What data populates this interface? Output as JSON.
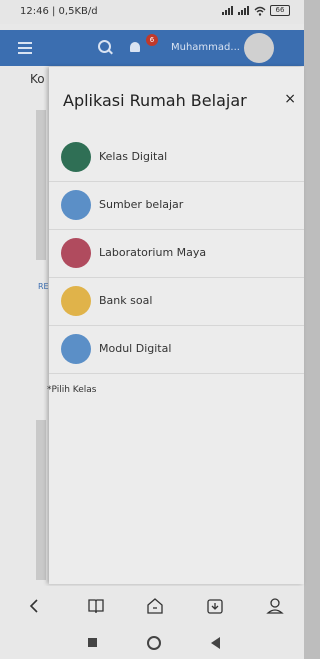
{
  "status_bar": {
    "time": "12:46 | 0,5KB/d",
    "battery": "66"
  },
  "app_bar": {
    "notification_count": "6",
    "user_name": "Muhammad..."
  },
  "background": {
    "partial_heading": "Ko",
    "partial_label": "RE"
  },
  "drawer": {
    "title": "Aplikasi Rumah Belajar",
    "close": "×",
    "items": [
      {
        "label": "Kelas Digital",
        "icon": "kelas-digital-icon",
        "color": "#2f6f55"
      },
      {
        "label": "Sumber belajar",
        "icon": "sumber-belajar-icon",
        "color": "#5b8fc7"
      },
      {
        "label": "Laboratorium Maya",
        "icon": "laboratorium-maya-icon",
        "color": "#b04b5e"
      },
      {
        "label": "Bank soal",
        "icon": "bank-soal-icon",
        "color": "#e0b34a"
      },
      {
        "label": "Modul Digital",
        "icon": "modul-digital-icon",
        "color": "#5b8fc7"
      }
    ],
    "footer_label": "Pilih Kelas",
    "footer_prefix": "*"
  },
  "bottom_nav": [
    "back-icon",
    "book-icon",
    "home-icon",
    "download-folder-icon",
    "profile-icon"
  ],
  "system_nav": [
    "recent-apps-icon",
    "home-circle-icon",
    "back-triangle-icon"
  ]
}
